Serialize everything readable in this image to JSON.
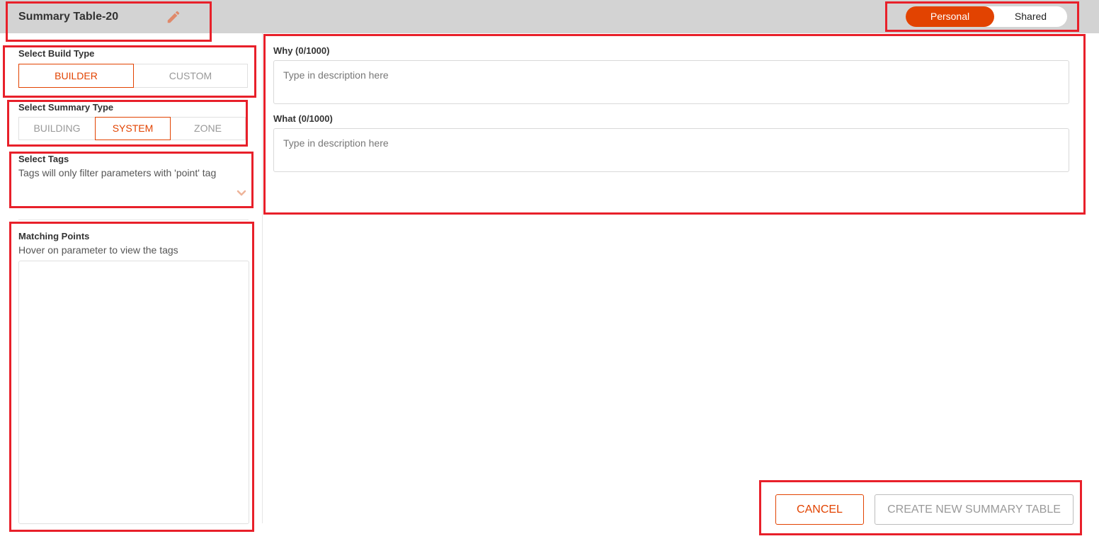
{
  "header": {
    "title": "Summary Table-20",
    "toggle": {
      "personal_label": "Personal",
      "shared_label": "Shared",
      "selected": "Personal"
    }
  },
  "build_type": {
    "label": "Select Build Type",
    "options": [
      "BUILDER",
      "CUSTOM"
    ],
    "selected": "BUILDER"
  },
  "summary_type": {
    "label": "Select Summary Type",
    "options": [
      "BUILDING",
      "SYSTEM",
      "ZONE"
    ],
    "selected": "SYSTEM"
  },
  "tags": {
    "label": "Select Tags",
    "hint": "Tags will only filter parameters with 'point' tag"
  },
  "matching_points": {
    "label": "Matching Points",
    "hint": "Hover on parameter to view the tags"
  },
  "why": {
    "label": "Why (0/1000)",
    "placeholder": "Type in description here",
    "value": ""
  },
  "what": {
    "label": "What (0/1000)",
    "placeholder": "Type in description here",
    "value": ""
  },
  "actions": {
    "cancel_label": "CANCEL",
    "create_label": "CREATE NEW SUMMARY TABLE"
  },
  "colors": {
    "accent": "#e24301",
    "highlight": "#e8202a",
    "topbar": "#d3d3d3"
  },
  "icons": {
    "edit": "pencil-icon",
    "dropdown": "chevron-down-icon"
  }
}
